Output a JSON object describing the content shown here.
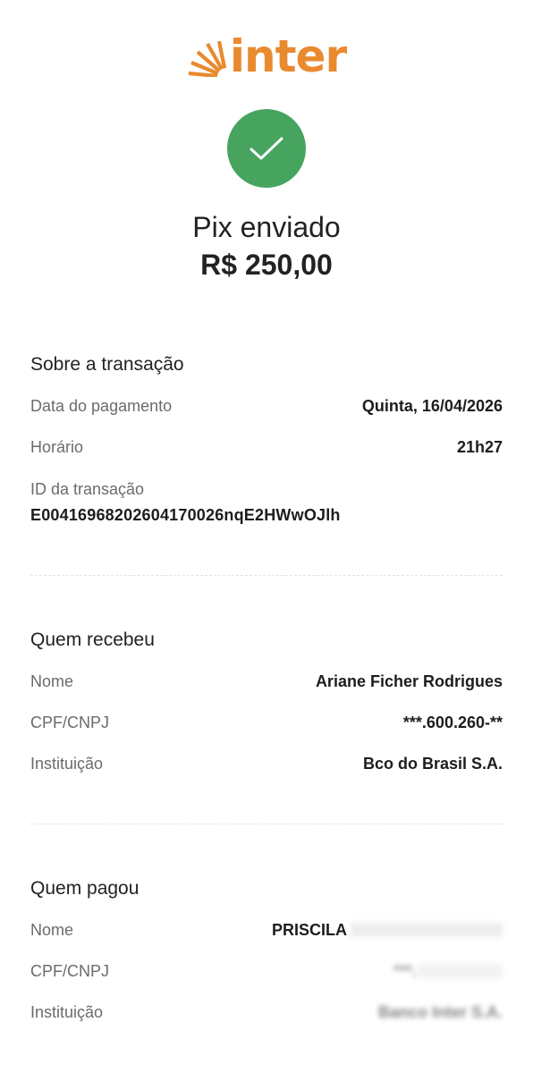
{
  "brand": {
    "name": "inter",
    "color": "#e98a2f"
  },
  "status": {
    "icon": "checkmark-icon",
    "color": "#46a45f"
  },
  "header": {
    "title": "Pix enviado",
    "amount": "R$ 250,00"
  },
  "transaction": {
    "title": "Sobre a transação",
    "date_label": "Data do pagamento",
    "date_value": "Quinta, 16/04/2026",
    "time_label": "Horário",
    "time_value": "21h27",
    "id_label": "ID da transação",
    "id_value": "E00416968202604170026nqE2HWwOJlh"
  },
  "receiver": {
    "title": "Quem recebeu",
    "name_label": "Nome",
    "name_value": "Ariane Ficher Rodrigues",
    "doc_label": "CPF/CNPJ",
    "doc_value": "***.600.260-**",
    "bank_label": "Instituição",
    "bank_value": "Bco do Brasil S.A."
  },
  "payer": {
    "title": "Quem pagou",
    "name_label": "Nome",
    "name_value": "PRISCILA",
    "doc_label": "CPF/CNPJ",
    "doc_value": "***.",
    "bank_label": "Instituição",
    "bank_value": "Banco Inter S.A."
  }
}
